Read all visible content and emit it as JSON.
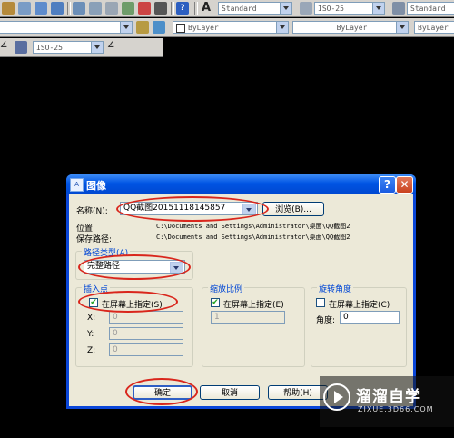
{
  "toolbar1": {
    "text_style": "Standard",
    "dim_style": "ISO-25",
    "table_style": "Standard",
    "icons": [
      "match-properties-icon",
      "zoom-realtime-icon",
      "zoom-window-icon",
      "zoom-previous-icon",
      "properties-icon",
      "design-center-icon",
      "tool-palettes-icon",
      "sheet-set-icon",
      "markup-icon",
      "calculator-icon",
      "help-icon"
    ]
  },
  "toolbar2": {
    "color": "ByLayer",
    "linetype": "ByLayer",
    "lineweight": "ByLayer"
  },
  "toolbar3": {
    "dim_style": "ISO-25"
  },
  "dialog": {
    "title": "图像",
    "name_label": "名称(N):",
    "name_value": "QQ截图20151118145857",
    "browse_label": "浏览(B)...",
    "location_label": "位置:",
    "location_value": "C:\\Documents and Settings\\Administrator\\桌面\\QQ截图2",
    "saved_path_label": "保存路径:",
    "saved_path_value": "C:\\Documents and Settings\\Administrator\\桌面\\QQ截图2",
    "path_type_label": "路径类型(A)",
    "path_type_value": "完整路径",
    "insertion": {
      "title": "插入点",
      "specify_label": "在屏幕上指定(S)",
      "specify_checked": true,
      "x_label": "X:",
      "x_value": "0",
      "y_label": "Y:",
      "y_value": "0",
      "z_label": "Z:",
      "z_value": "0"
    },
    "scale": {
      "title": "缩放比例",
      "specify_label": "在屏幕上指定(E)",
      "specify_checked": true,
      "value": "1"
    },
    "rotation": {
      "title": "旋转角度",
      "specify_label": "在屏幕上指定(C)",
      "specify_checked": false,
      "angle_label": "角度:",
      "angle_value": "0"
    },
    "ok_label": "确定",
    "cancel_label": "取消",
    "help_label": "帮助(H)"
  },
  "watermark": {
    "name": "溜溜自学",
    "url": "ZIXUE.3D66.COM"
  }
}
